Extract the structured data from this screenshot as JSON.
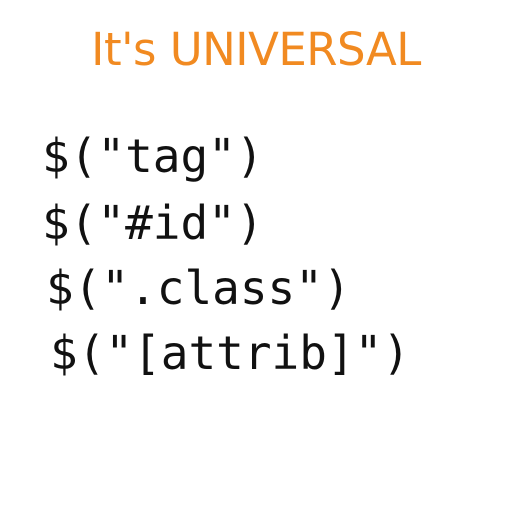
{
  "title": "It's UNIVERSAL",
  "accent_color": "#f18a21",
  "code_lines": [
    "$(\"tag\")",
    "$(\"#id\")",
    "$(\".class\")",
    "$(\"[attrib]\")"
  ]
}
